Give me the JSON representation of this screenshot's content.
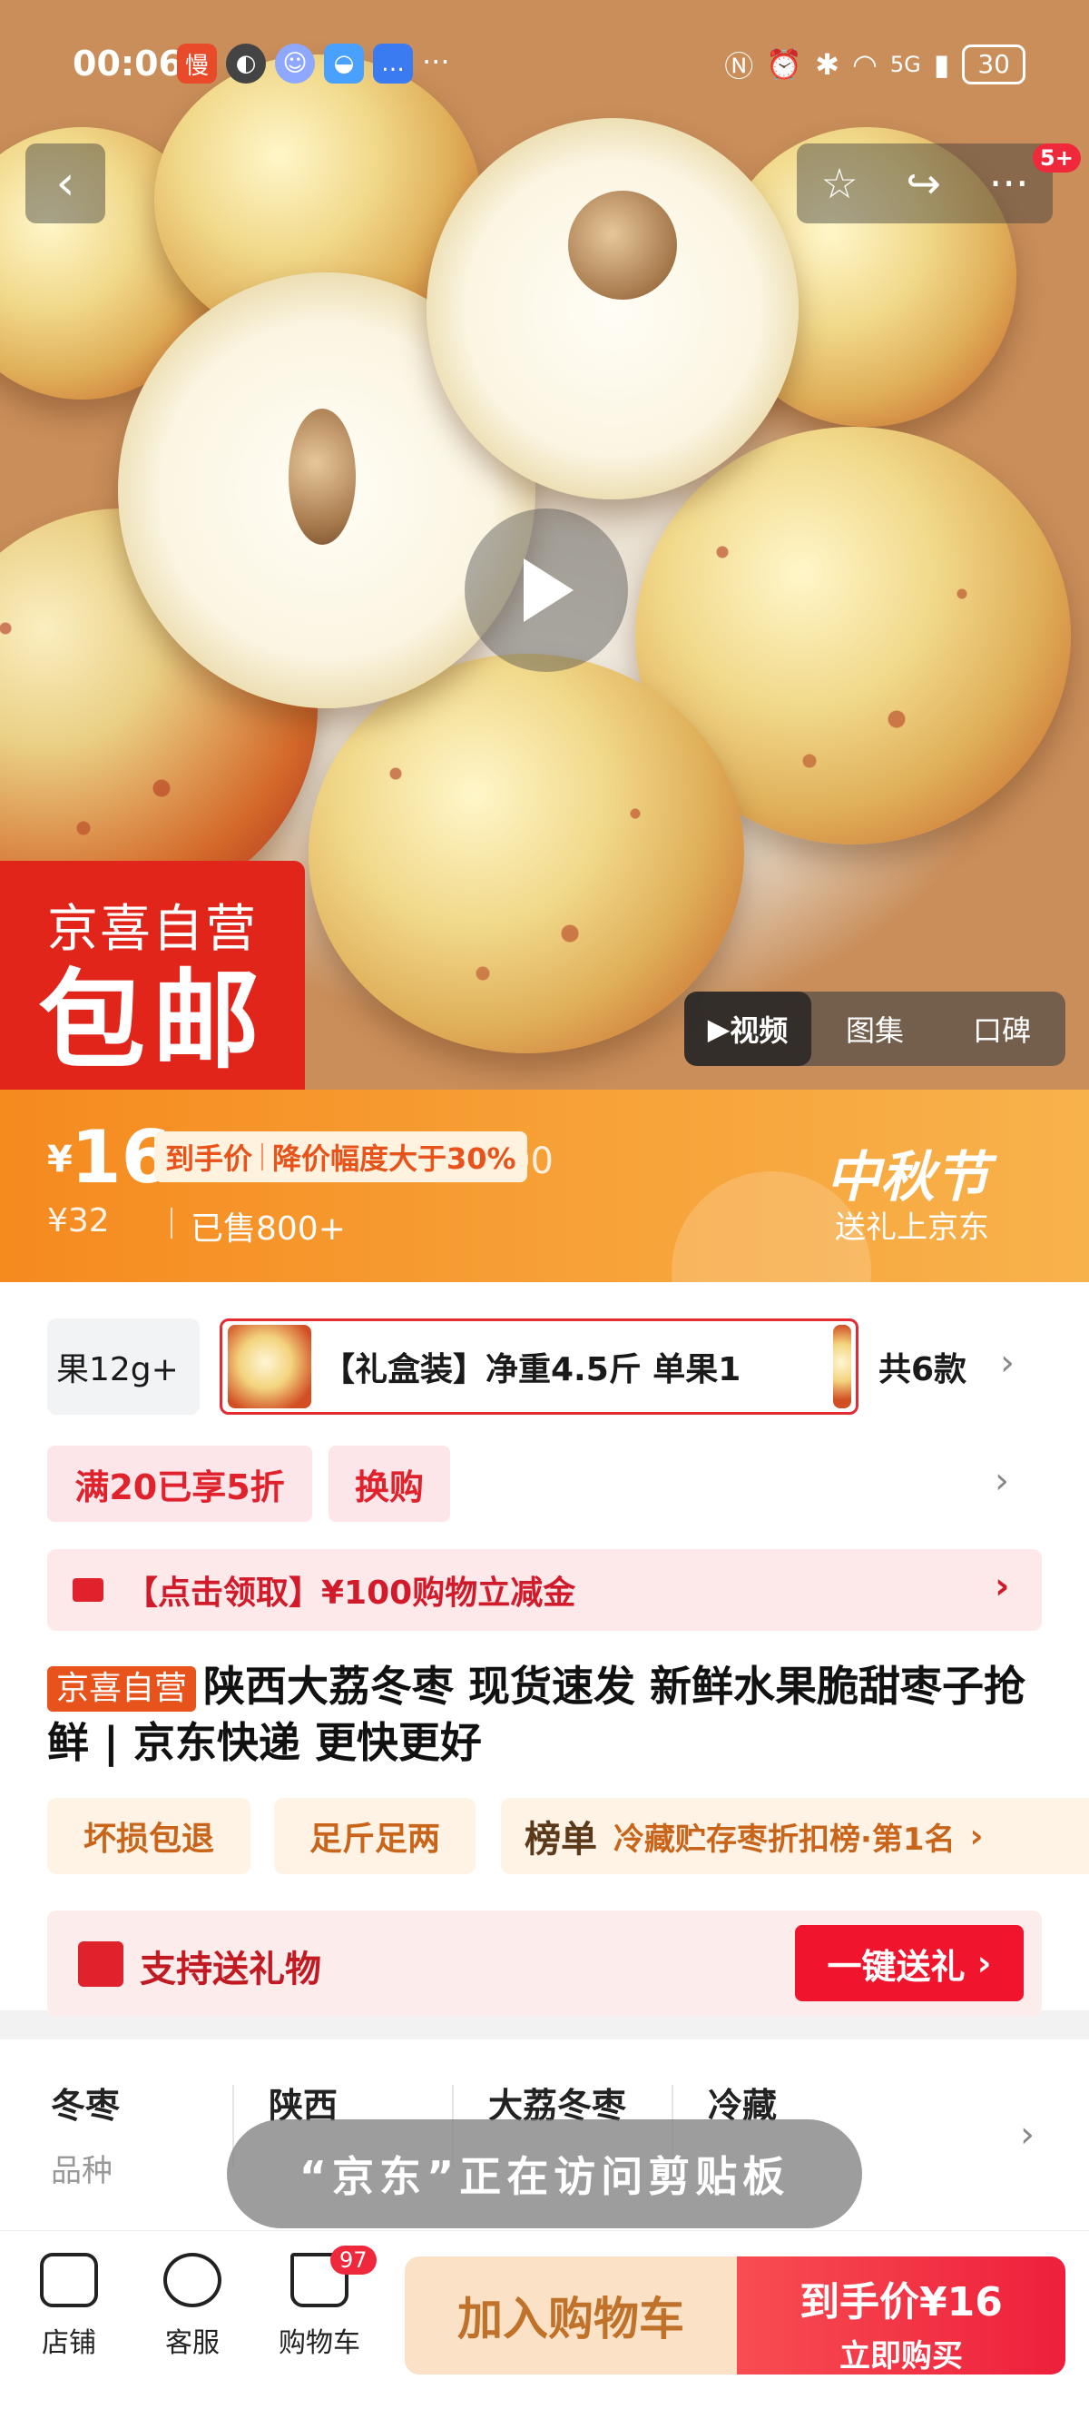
{
  "status_bar": {
    "time": "00:06",
    "network": "5G",
    "battery": "30"
  },
  "hero": {
    "badge_count": "5+",
    "tag_line1": "京喜自营",
    "tag_line2": "包邮",
    "media_tabs": [
      "视频",
      "图集",
      "口碑"
    ]
  },
  "price": {
    "currency": "¥",
    "amount": "16",
    "label_a": "到手价",
    "label_b": "降价幅度大于30%",
    "ghost": "¥32.00",
    "original": "¥32",
    "sold": "已售800+",
    "festival": "中秋节",
    "festival_sub": "送礼上京东"
  },
  "skus": {
    "item0": "果12g+",
    "item1": "【礼盒装】净重4.5斤 单果1",
    "count": "共6款"
  },
  "promos": {
    "discount": "满20已享5折",
    "swap": "换购"
  },
  "coupon": {
    "text": "【点击领取】¥100购物立减金"
  },
  "product": {
    "shop_tag": "京喜自营",
    "title": "陕西大荔冬枣 现货速发 新鲜水果脆甜枣子抢鲜 | 京东快递 更快更好"
  },
  "tags": {
    "t1": "坏损包退",
    "t2": "足斤足两",
    "rank_label": "榜单",
    "rank_text": "冷藏贮存枣折扣榜·第1名"
  },
  "gift": {
    "text": "支持送礼物",
    "button": "一键送礼"
  },
  "specs": [
    {
      "value": "冬枣",
      "key": "品种"
    },
    {
      "value": "陕西",
      "key": ""
    },
    {
      "value": "大荔冬枣",
      "key": ""
    },
    {
      "value": "冷藏",
      "key": ""
    }
  ],
  "toast": {
    "text": "“京东”正在访问剪贴板"
  },
  "bottom_bar": {
    "shop": "店铺",
    "service": "客服",
    "cart": "购物车",
    "cart_count": "97",
    "add_cart": "加入购物车",
    "buy_price": "到手价¥16",
    "buy_now": "立即购买"
  },
  "colors": {
    "brand_red": "#e1251b",
    "price_orange": "#f58a1f",
    "buy_red": "#ee1f3b"
  }
}
